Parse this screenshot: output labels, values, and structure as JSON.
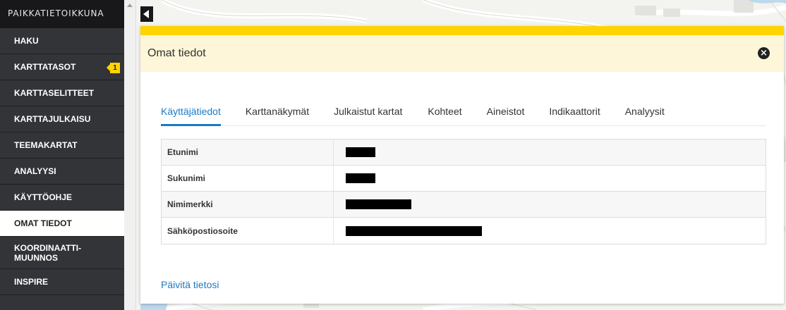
{
  "sidebar": {
    "title": "PAIKKATIETOIKKUNA",
    "items": [
      {
        "label": "HAKU"
      },
      {
        "label": "KARTTATASOT",
        "badge": "1"
      },
      {
        "label": "KARTTASELITTEET"
      },
      {
        "label": "KARTTAJULKAISU"
      },
      {
        "label": "TEEMAKARTAT"
      },
      {
        "label": "ANALYYSI"
      },
      {
        "label": "KÄYTTÖOHJE"
      },
      {
        "label": "OMAT TIEDOT",
        "active": true
      },
      {
        "label_line1": "KOORDINAATTI-",
        "label_line2": "MUUNNOS"
      },
      {
        "label": "INSPIRE"
      }
    ]
  },
  "panel": {
    "title": "Omat tiedot",
    "tabs": [
      {
        "label": "Käyttäjätiedot",
        "active": true
      },
      {
        "label": "Karttanäkymät"
      },
      {
        "label": "Julkaistut kartat"
      },
      {
        "label": "Kohteet"
      },
      {
        "label": "Aineistot"
      },
      {
        "label": "Indikaattorit"
      },
      {
        "label": "Analyysit"
      }
    ],
    "fields": [
      {
        "label": "Etunimi"
      },
      {
        "label": "Sukunimi"
      },
      {
        "label": "Nimimerkki"
      },
      {
        "label": "Sähköpostiosoite"
      }
    ],
    "update_link": "Päivitä tietosi"
  },
  "colors": {
    "accent_yellow": "#ffd400",
    "link_blue": "#1a7ac8",
    "sidebar_bg": "#333438",
    "header_bg": "#18181a"
  },
  "icons": {
    "close": "close-icon",
    "collapse": "collapse-left-icon"
  }
}
